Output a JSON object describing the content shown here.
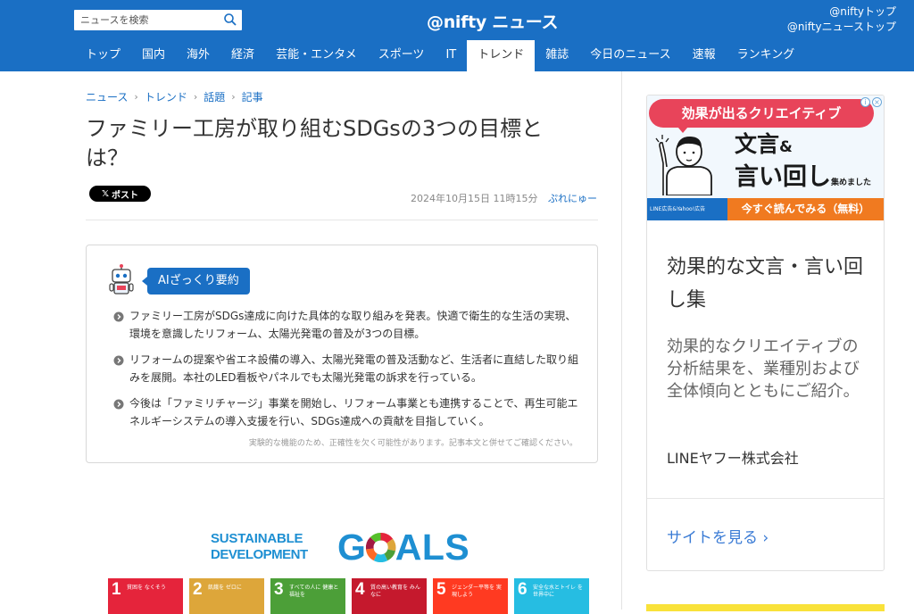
{
  "header": {
    "search_placeholder": "ニュースを検索",
    "logo": "@nifty ニュース",
    "top_links": [
      "@niftyトップ",
      "@niftyニューストップ"
    ],
    "nav": [
      "トップ",
      "国内",
      "海外",
      "経済",
      "芸能・エンタメ",
      "スポーツ",
      "IT",
      "トレンド",
      "雑誌",
      "今日のニュース",
      "速報",
      "ランキング"
    ],
    "active_nav": "トレンド"
  },
  "breadcrumb": [
    "ニュース",
    "トレンド",
    "話題",
    "記事"
  ],
  "article": {
    "title": "ファミリー工房が取り組むSDGsの3つの目標とは？",
    "post_button": "ポスト",
    "date": "2024年10月15日 11時15分",
    "source": "ぷれにゅー"
  },
  "summary": {
    "badge": "AIざっくり要約",
    "items": [
      "ファミリー工房がSDGs達成に向けた具体的な取り組みを発表。快適で衛生的な生活の実現、環境を意識したリフォーム、太陽光発電の普及が3つの目標。",
      "リフォームの提案や省エネ設備の導入、太陽光発電の普及活動など、生活者に直結した取り組みを展開。本社のLED看板やパネルでも太陽光発電の訴求を行っている。",
      "今後は「ファミリチャージ」事業を開始し、リフォーム事業とも連携することで、再生可能エネルギーシステムの導入支援を行い、SDGs達成への貢献を目指していく。"
    ],
    "disclaimer": "実験的な機能のため、正確性を欠く可能性があります。記事本文と併せてご確認ください。"
  },
  "sdg_image": {
    "line1": "SUSTAINABLE",
    "line2": "DEVELOPMENT",
    "goals": "GOALS",
    "tiles": [
      {
        "num": "1",
        "label": "貧困を なくそう",
        "color": "#e5243b"
      },
      {
        "num": "2",
        "label": "飢餓を ゼロに",
        "color": "#dda63a"
      },
      {
        "num": "3",
        "label": "すべての人に 健康と福祉を",
        "color": "#4c9f38"
      },
      {
        "num": "4",
        "label": "質の高い教育を みんなに",
        "color": "#c5192d"
      },
      {
        "num": "5",
        "label": "ジェンダー平等を 実現しよう",
        "color": "#ff3a21"
      },
      {
        "num": "6",
        "label": "安全な水とトイレ を世界中に",
        "color": "#26bde2"
      }
    ]
  },
  "ad": {
    "pill": "効果が出るクリエイティブ",
    "head1": "文言",
    "head1_amp": "&",
    "head2": "言い回し",
    "head2_small": "集めました",
    "strip_left": "LINE広告&Yahoo!広告",
    "strip_right": "今すぐ読んでみる（無料）",
    "title": "効果的な文言・言い回し集",
    "description": "効果的なクリエイティブの分析結果を、業種別および全体傾向とともにご紹介。",
    "company": "LINEヤフー株式会社",
    "cta": "サイトを見る"
  },
  "colors": {
    "brand_blue": "#1a6fc4",
    "ad_pink": "#e8445a",
    "ad_orange": "#f07a20",
    "sdg_blue": "#1e8fd2"
  }
}
